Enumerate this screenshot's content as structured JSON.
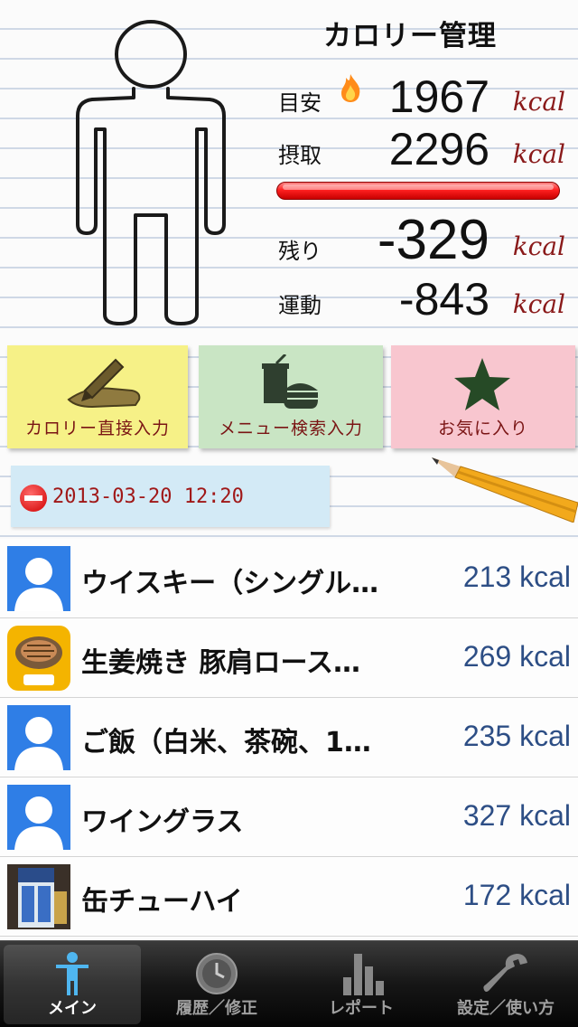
{
  "header": {
    "title": "カロリー管理"
  },
  "stats": {
    "target": {
      "label": "目安",
      "value": "1967",
      "unit": "kcal"
    },
    "intake": {
      "label": "摂取",
      "value": "2296",
      "unit": "kcal"
    },
    "remaining": {
      "label": "残り",
      "value": "-329",
      "unit": "kcal"
    },
    "exercise": {
      "label": "運動",
      "value": "-843",
      "unit": "kcal"
    },
    "bar_color": "#e00000"
  },
  "buttons": {
    "direct": "カロリー直接入力",
    "menu_search": "メニュー検索入力",
    "favorites": "お気に入り"
  },
  "meal": {
    "datetime": "2013-03-20 12:20"
  },
  "entries": [
    {
      "name": "ウイスキー（シングル…",
      "kcal": "213 kcal",
      "icon": "person-placeholder-icon"
    },
    {
      "name": "生姜焼き 豚肩ロース…",
      "kcal": "269 kcal",
      "icon": "yakiniku-icon"
    },
    {
      "name": "ご飯（白米、茶碗、1…",
      "kcal": "235 kcal",
      "icon": "person-placeholder-icon"
    },
    {
      "name": "ワイングラス",
      "kcal": "327 kcal",
      "icon": "person-placeholder-icon"
    },
    {
      "name": "缶チューハイ",
      "kcal": "172 kcal",
      "icon": "can-chuhai-photo"
    }
  ],
  "tabs": [
    {
      "label": "メイン",
      "icon": "person-icon",
      "active": true
    },
    {
      "label": "履歴／修正",
      "icon": "clock-icon"
    },
    {
      "label": "レポート",
      "icon": "bar-chart-icon"
    },
    {
      "label": "設定／使い方",
      "icon": "wrench-icon"
    }
  ],
  "colors": {
    "accent_text": "#8a1a1a",
    "kcal_blue": "#2d4e85",
    "thumb_blue": "#2f7ee6"
  }
}
